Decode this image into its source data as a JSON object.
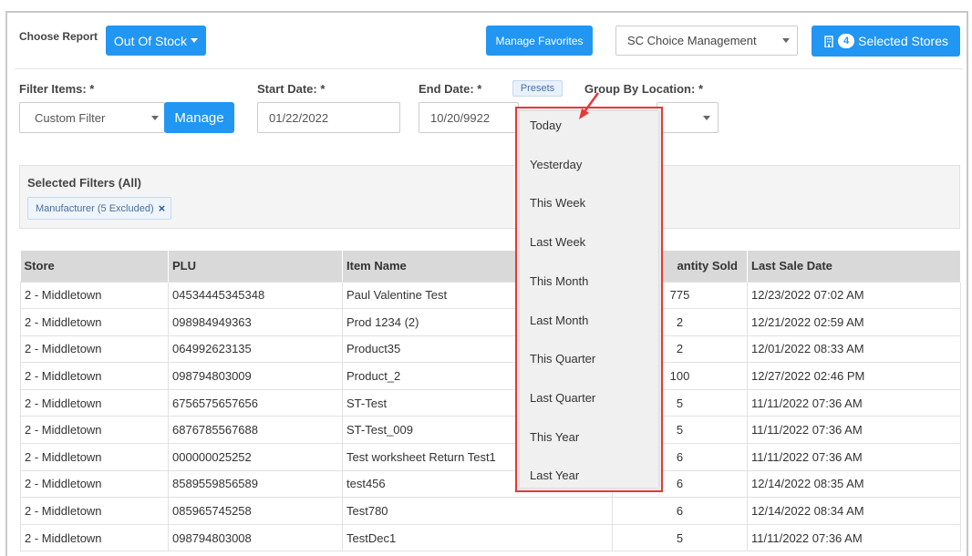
{
  "toolbar": {
    "choose_report_label": "Choose Report",
    "report_button": "Out Of Stock",
    "manage_favorites": "Manage Favorites",
    "management_select": "SC Choice Management",
    "store_count": "4",
    "selected_stores": "Selected Stores"
  },
  "filters": {
    "filter_items_label": "Filter Items: *",
    "filter_select": "Custom Filter",
    "manage_button": "Manage",
    "start_date_label": "Start Date: *",
    "start_date_value": "01/22/2022",
    "end_date_label": "End Date: *",
    "end_date_value": "10/20/9922",
    "presets_label": "Presets",
    "group_by_label": "Group By Location: *"
  },
  "selected_filters": {
    "title": "Selected Filters (All)",
    "tag": "Manufacturer (5 Excluded)",
    "tag_remove": "×"
  },
  "presets_dropdown": {
    "items": [
      "Today",
      "Yesterday",
      "This Week",
      "Last Week",
      "This Month",
      "Last Month",
      "This Quarter",
      "Last Quarter",
      "This Year",
      "Last Year"
    ]
  },
  "table": {
    "columns": [
      "Store",
      "PLU",
      "Item Name",
      "antity Sold",
      "Last Sale Date"
    ],
    "rows": [
      [
        "2 - Middletown",
        "04534445345348",
        "Paul Valentine Test",
        "775",
        "12/23/2022 07:02 AM"
      ],
      [
        "2 - Middletown",
        "098984949363",
        "Prod 1234 (2)",
        "2",
        "12/21/2022 02:59 AM"
      ],
      [
        "2 - Middletown",
        "064992623135",
        "Product35",
        "2",
        "12/01/2022 08:33 AM"
      ],
      [
        "2 - Middletown",
        "098794803009",
        "Product_2",
        "100",
        "12/27/2022 02:46 PM"
      ],
      [
        "2 - Middletown",
        "6756575657656",
        "ST-Test",
        "5",
        "11/11/2022 07:36 AM"
      ],
      [
        "2 - Middletown",
        "6876785567688",
        "ST-Test_009",
        "5",
        "11/11/2022 07:36 AM"
      ],
      [
        "2 - Middletown",
        "000000025252",
        "Test worksheet Return Test1",
        "6",
        "11/11/2022 07:36 AM"
      ],
      [
        "2 - Middletown",
        "8589559856589",
        "test456",
        "6",
        "12/14/2022 08:35 AM"
      ],
      [
        "2 - Middletown",
        "085965745258",
        "Test780",
        "6",
        "12/14/2022 08:34 AM"
      ],
      [
        "2 - Middletown",
        "098794803008",
        "TestDec1",
        "5",
        "11/11/2022 07:36 AM"
      ]
    ]
  },
  "colors": {
    "accent": "#2196f3",
    "highlight_border": "#e53935"
  }
}
